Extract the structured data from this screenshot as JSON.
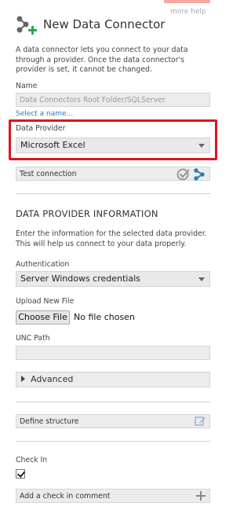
{
  "header": {
    "title": "New Data Connector",
    "more_help": "more help"
  },
  "intro": "A data connector lets you connect to your data through a provider. Once the data connector's provider is set, it cannot be changed.",
  "name_field": {
    "label": "Name",
    "placeholder": "Data Connectors Root Folder/SQLServer",
    "select_link": "Select a name..."
  },
  "data_provider": {
    "label": "Data Provider",
    "selected": "Microsoft Excel",
    "highlight_color": "#e0141c"
  },
  "test_connection": {
    "label": "Test connection"
  },
  "provider_info": {
    "title": "DATA PROVIDER INFORMATION",
    "description": "Enter the information for the selected data provider. This will help us connect to your data properly."
  },
  "authentication": {
    "label": "Authentication",
    "selected": "Server Windows credentials"
  },
  "upload": {
    "label": "Upload New File",
    "button": "Choose File",
    "status": "No file chosen"
  },
  "unc_path": {
    "label": "UNC Path",
    "value": ""
  },
  "advanced": {
    "label": "Advanced"
  },
  "define_structure": {
    "label": "Define structure"
  },
  "check_in": {
    "label": "Check In",
    "checked": true,
    "comment_label": "Add a check in comment"
  },
  "colors": {
    "accent": "#2b7bb9",
    "icon_green": "#2ea44f",
    "field_bg": "#ececec"
  }
}
